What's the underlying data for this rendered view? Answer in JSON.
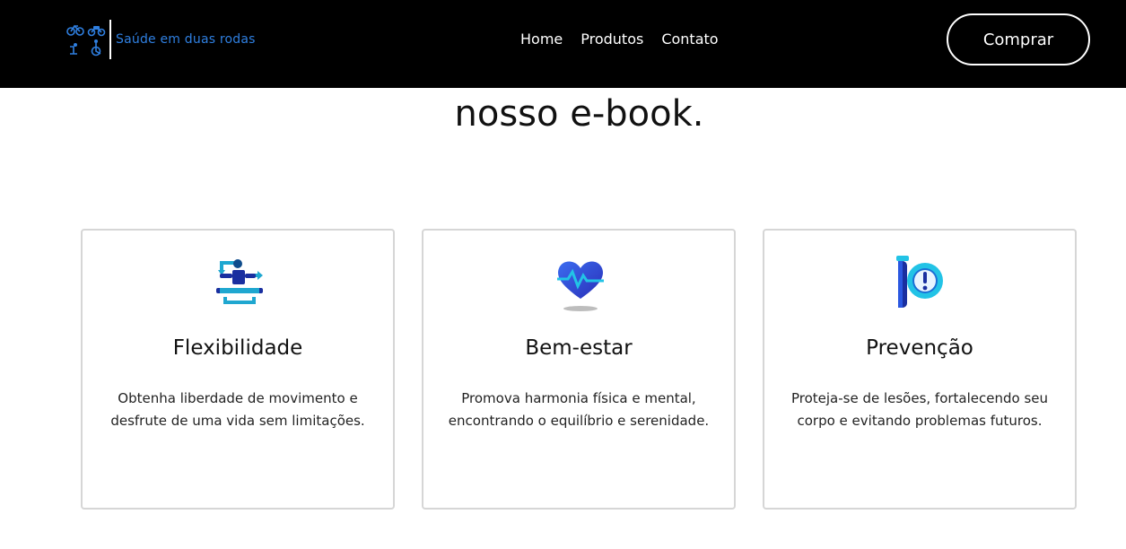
{
  "brand": {
    "name": "Saúde em duas rodas",
    "color": "#2f7fe0"
  },
  "nav": {
    "items": [
      "Home",
      "Produtos",
      "Contato"
    ]
  },
  "header": {
    "buy_label": "Comprar"
  },
  "main": {
    "headline": "nosso e-book."
  },
  "cards": [
    {
      "icon": "stretching-exercise-icon",
      "title": "Flexibilidade",
      "text": "Obtenha liberdade de movimento e desfrute de uma vida sem limitações."
    },
    {
      "icon": "heart-pulse-icon",
      "title": "Bem-estar",
      "text": "Promova harmonia física e mental, encontrando o equilíbrio e serenidade."
    },
    {
      "icon": "test-tube-alert-icon",
      "title": "Prevenção",
      "text": "Proteja-se de lesões, fortalecendo seu corpo e evitando problemas futuros."
    }
  ]
}
